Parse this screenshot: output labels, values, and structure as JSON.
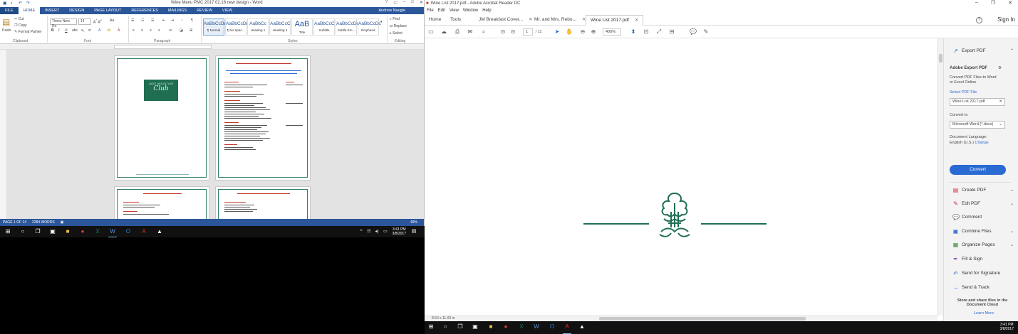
{
  "word": {
    "title": "Wine Menu PMC 2017 02.16 new design - Word",
    "tabs": [
      "FILE",
      "HOME",
      "INSERT",
      "DESIGN",
      "PAGE LAYOUT",
      "REFERENCES",
      "MAILINGS",
      "REVIEW",
      "VIEW"
    ],
    "active_tab": "HOME",
    "user": "Andrew Naugle",
    "clipboard": {
      "paste": "Paste",
      "cut": "Cut",
      "copy": "Copy",
      "format_painter": "Format Painter",
      "label": "Clipboard"
    },
    "font": {
      "name": "Times New Ro",
      "size": "14",
      "label": "Font"
    },
    "paragraph_label": "Paragraph",
    "styles": [
      {
        "sample": "AaBbCcDc",
        "name": "¶ Normal"
      },
      {
        "sample": "AaBbCcDc",
        "name": "¶ No Spac..."
      },
      {
        "sample": "AaBbCc",
        "name": "Heading 1"
      },
      {
        "sample": "AaBbCcC",
        "name": "Heading 2"
      },
      {
        "sample": "AaB",
        "name": "Title"
      },
      {
        "sample": "AaBbCcC",
        "name": "Subtitle"
      },
      {
        "sample": "AaBbCcDc",
        "name": "Subtle Em..."
      },
      {
        "sample": "AaBbCcDc",
        "name": "Emphasis"
      }
    ],
    "styles_label": "Styles",
    "editing": {
      "find": "Find",
      "replace": "Replace",
      "select": "Select",
      "label": "Editing"
    },
    "page1_logo_top": "JADE MOUNTAIN",
    "page1_logo_main": "Club",
    "status": {
      "page": "PAGE 1 OF 14",
      "words": "2284 WORDS",
      "zoom": "49%"
    }
  },
  "taskbar_left": {
    "time": "3:41 PM",
    "date": "3/8/2017"
  },
  "acrobat": {
    "title": "Wine List 2017.pdf - Adobe Acrobat Reader DC",
    "menu": [
      "File",
      "Edit",
      "View",
      "Window",
      "Help"
    ],
    "tabs": [
      {
        "label": "Home"
      },
      {
        "label": "Tools"
      },
      {
        "label": "JM Breakfast Cover..."
      },
      {
        "label": "Mr. and Mrs. Rebo..."
      },
      {
        "label": "Wine List 2017.pdf"
      }
    ],
    "sign_in": "Sign In",
    "page_num": "1",
    "page_total": "/ 11",
    "zoom": "400%",
    "page_size": "8.50 x 11.00 in",
    "pane": {
      "export_pdf": "Export PDF",
      "adobe_export_pdf": "Adobe Export PDF",
      "desc": [
        "Convert PDF Files to Word",
        "or Excel Online"
      ],
      "select_file": "Select PDF File",
      "file_name": "Wine List 2017.pdf",
      "convert_to": "Convert to",
      "format": "Microsoft Word (*.docx)",
      "doc_lang": "Document Language:",
      "lang": "English (U.S.)",
      "change": "Change",
      "convert": "Convert",
      "tools": [
        {
          "label": "Create PDF",
          "icon": "create-pdf-icon",
          "chev": true
        },
        {
          "label": "Edit PDF",
          "icon": "edit-pdf-icon",
          "chev": true
        },
        {
          "label": "Comment",
          "icon": "comment-icon",
          "chev": false
        },
        {
          "label": "Combine Files",
          "icon": "combine-files-icon",
          "chev": true
        },
        {
          "label": "Organize Pages",
          "icon": "organize-pages-icon",
          "chev": true
        },
        {
          "label": "Fill & Sign",
          "icon": "fill-sign-icon",
          "chev": false
        },
        {
          "label": "Send for Signature",
          "icon": "send-signature-icon",
          "chev": false
        },
        {
          "label": "Send & Track",
          "icon": "send-track-icon",
          "chev": false
        }
      ],
      "cloud": [
        "Store and share files in the",
        "Document Cloud"
      ],
      "learn_more": "Learn More"
    }
  },
  "taskbar_right": {
    "time": "3:41 PM",
    "date": "3/8/2017"
  }
}
